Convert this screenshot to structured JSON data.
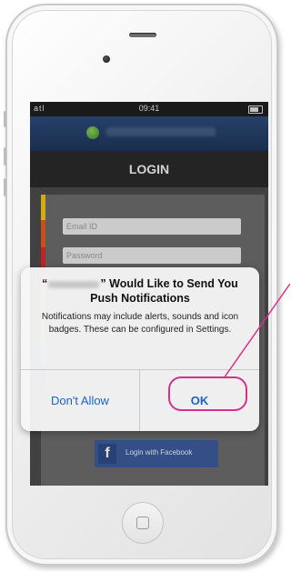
{
  "statusbar": {
    "signal": "atl",
    "time": "09:41"
  },
  "screen": {
    "title": "LOGIN",
    "email_placeholder": "Email ID",
    "password_placeholder": "Password",
    "facebook_icon_letter": "f",
    "facebook_button": "Login with Facebook"
  },
  "alert": {
    "title_prefix": "“",
    "title_suffix": "” Would Like to Send You Push Notifications",
    "message": "Notifications may include alerts, sounds and icon badges. These can be configured in Settings.",
    "dont_allow": "Don't Allow",
    "ok": "OK"
  },
  "colors": {
    "accent_highlight": "#d6318a",
    "ios_button_blue": "#1b63c4",
    "app_header": "#1d3559",
    "facebook_blue": "#3b5a98",
    "stripes": [
      "#f2c31b",
      "#e55a1c",
      "#d92a2a",
      "#8dc63f",
      "#2d9cdb",
      "#1c4f9c",
      "#5e2f8e"
    ]
  }
}
